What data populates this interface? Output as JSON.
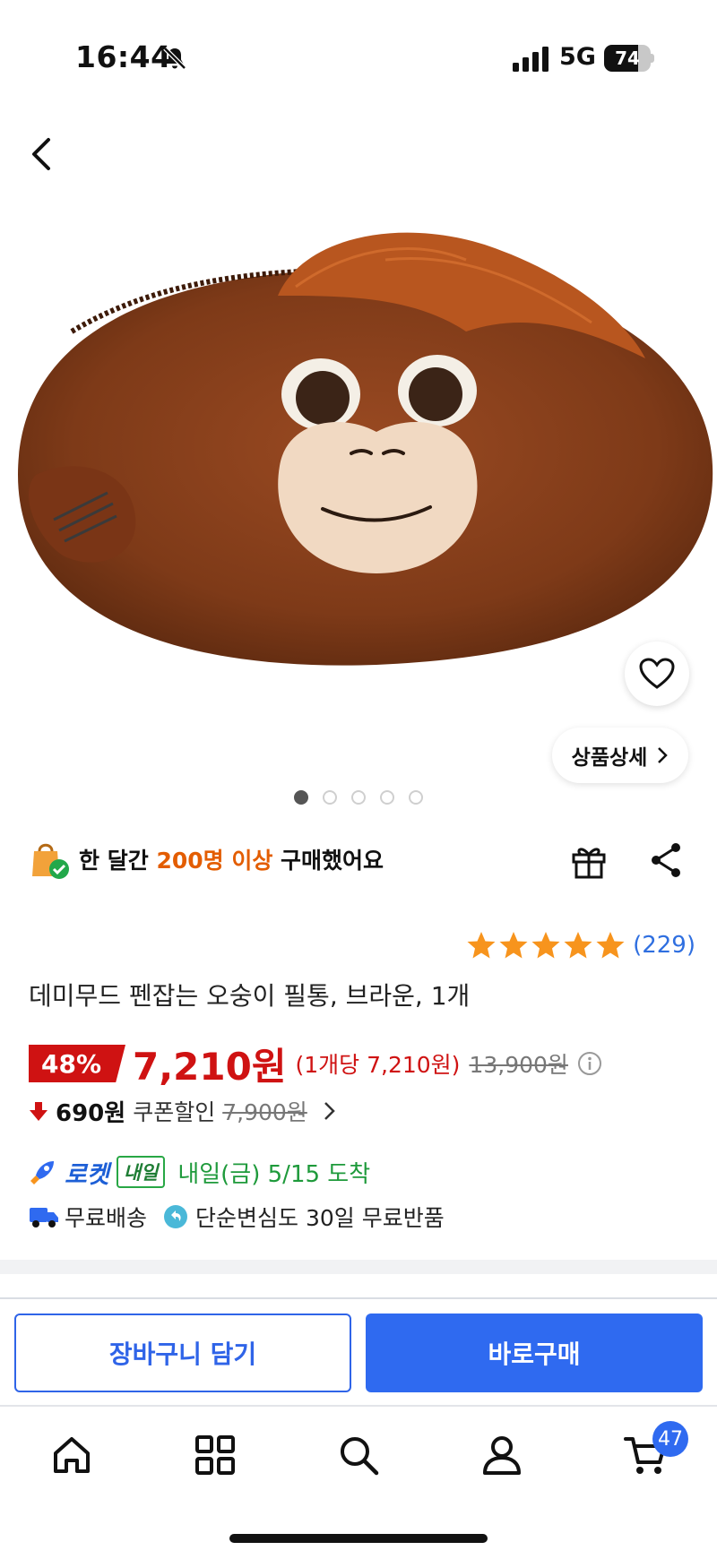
{
  "status_bar": {
    "time": "16:44",
    "network": "5G",
    "battery": "74",
    "battery_fraction": 0.74
  },
  "product": {
    "image_icon": "orangutan-pencil-case-image",
    "carousel": {
      "count": 5,
      "active": 0
    },
    "detail_link": "상품상세",
    "purchase": {
      "prefix": "한 달간",
      "highlight": "200명 이상",
      "suffix": "구매했어요"
    },
    "rating": {
      "stars": 5,
      "count": "(229)"
    },
    "title": "데미무드 펜잡는 오숭이 필통, 브라운, 1개",
    "price": {
      "discount": "48%",
      "sale": "7,210원",
      "unit": "(1개당 7,210원)",
      "original": "13,900원"
    },
    "coupon": {
      "amount": "690원",
      "label": "쿠폰할인",
      "price": "7,900원"
    },
    "delivery": {
      "rocket": "로켓",
      "badge": "내일",
      "arrival": "내일(금) 5/15 도착"
    },
    "shipping": {
      "free": "무료배송",
      "returns": "단순변심도 30일 무료반품"
    }
  },
  "actions": {
    "cart": "장바구니 담기",
    "buy": "바로구매"
  },
  "tab_bar": {
    "items": [
      "home-icon",
      "category-icon",
      "search-icon",
      "user-icon",
      "cart-icon"
    ],
    "cart_badge": "47"
  },
  "colors": {
    "accent": "#2f6af0",
    "price": "#cf1212",
    "highlight": "#e35d00",
    "delivery": "#1e9a3b",
    "star": "#f7941d"
  }
}
